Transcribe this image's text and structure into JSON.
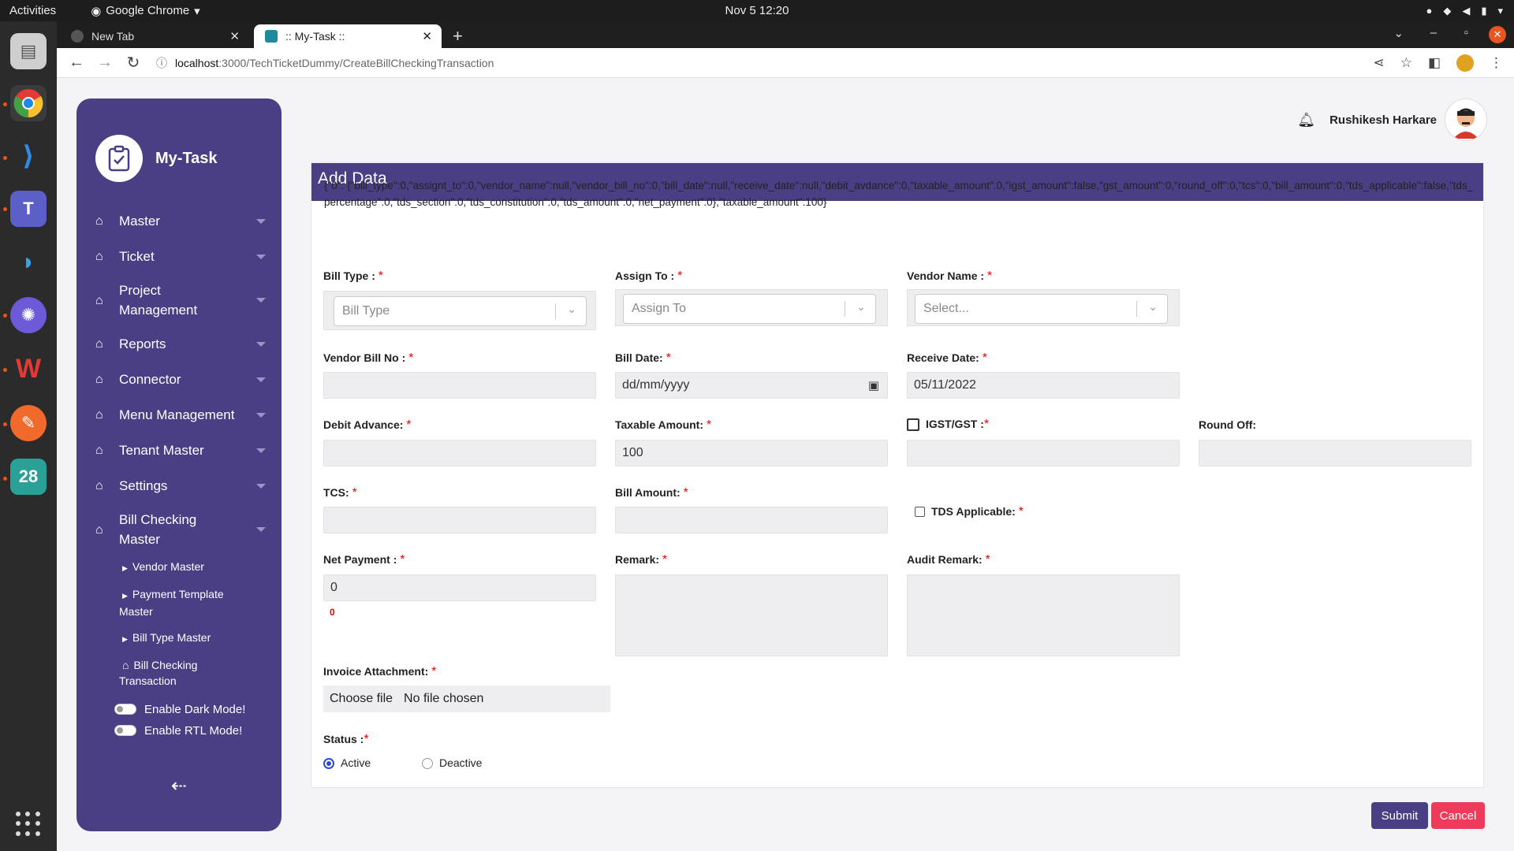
{
  "os": {
    "activities": "Activities",
    "app_name": "Google Chrome",
    "clock": "Nov 5  12:20",
    "dock_calendar": "28"
  },
  "browser": {
    "tabs": [
      {
        "label": "New Tab"
      },
      {
        "label": ":: My-Task ::"
      }
    ],
    "url_host": "localhost",
    "url_path": ":3000/TechTicketDummy/CreateBillCheckingTransaction"
  },
  "app": {
    "brand": "My-Task",
    "menu": [
      {
        "label": "Master"
      },
      {
        "label": "Ticket"
      },
      {
        "label": "Project Management"
      },
      {
        "label": "Reports"
      },
      {
        "label": "Connector"
      },
      {
        "label": "Menu Management"
      },
      {
        "label": "Tenant Master"
      },
      {
        "label": "Settings"
      },
      {
        "label": "Bill Checking Master"
      }
    ],
    "submenu": [
      {
        "label": "Vendor Master"
      },
      {
        "label": "Payment Template Master"
      },
      {
        "label": "Bill Type Master"
      },
      {
        "label": "Bill Checking Transaction"
      }
    ],
    "toggles": {
      "dark": "Enable Dark Mode!",
      "rtl": "Enable RTL Mode!"
    },
    "user_name": "Rushikesh Harkare"
  },
  "form": {
    "title": "Add Data",
    "json_dump": "{\"0\": {\"bill_type\":0,\"assignt_to\":0,\"vendor_name\":null,\"vendor_bill_no\":0,\"bill_date\":null,\"receive_date\":null,\"debit_avdance\":0,\"taxable_amount\":0,\"igst_amount\":false,\"gst_amount\":0,\"round_off\":0,\"tcs\":0,\"bill_amount\":0,\"tds_applicable\":false,\"tds_percentage\":0,\"tds_section\":0,\"tds_constitution\":0,\"tds_amount\":0,\"net_payment\":0},\"taxable_amount\":100}",
    "required_mark": "*",
    "bill_type": {
      "label": "Bill Type : ",
      "placeholder": "Bill Type"
    },
    "assign_to": {
      "label": "Assign To : ",
      "placeholder": "Assign To"
    },
    "vendor_name": {
      "label": "Vendor Name : ",
      "placeholder": "Select..."
    },
    "vendor_bill_no": {
      "label": "Vendor Bill No : ",
      "value": ""
    },
    "bill_date": {
      "label": "Bill Date: ",
      "value": "dd/mm/yyyy"
    },
    "receive_date": {
      "label": "Receive Date: ",
      "value": "05/11/2022"
    },
    "debit_advance": {
      "label": "Debit Advance: ",
      "value": ""
    },
    "taxable_amount": {
      "label": "Taxable Amount: ",
      "value": "100"
    },
    "igst_gst": {
      "label": "IGST/GST :",
      "value": ""
    },
    "round_off": {
      "label": "Round Off:",
      "value": ""
    },
    "tcs": {
      "label": "TCS: ",
      "value": ""
    },
    "bill_amount": {
      "label": "Bill Amount: ",
      "value": ""
    },
    "tds_applicable": {
      "label": "TDS Applicable: "
    },
    "net_payment": {
      "label": "Net Payment : ",
      "value": "0",
      "error": "0"
    },
    "remark": {
      "label": "Remark: "
    },
    "audit_remark": {
      "label": "Audit Remark: "
    },
    "invoice": {
      "label": "Invoice Attachment: ",
      "button": "Choose file",
      "status": "No file chosen"
    },
    "status": {
      "label": "Status :",
      "options": [
        "Active",
        "Deactive"
      ],
      "selected": "Active"
    },
    "submit": "Submit",
    "cancel": "Cancel"
  },
  "colors": {
    "primary": "#4a3f84",
    "danger": "#ee3b5b",
    "required": "#ee0000"
  }
}
